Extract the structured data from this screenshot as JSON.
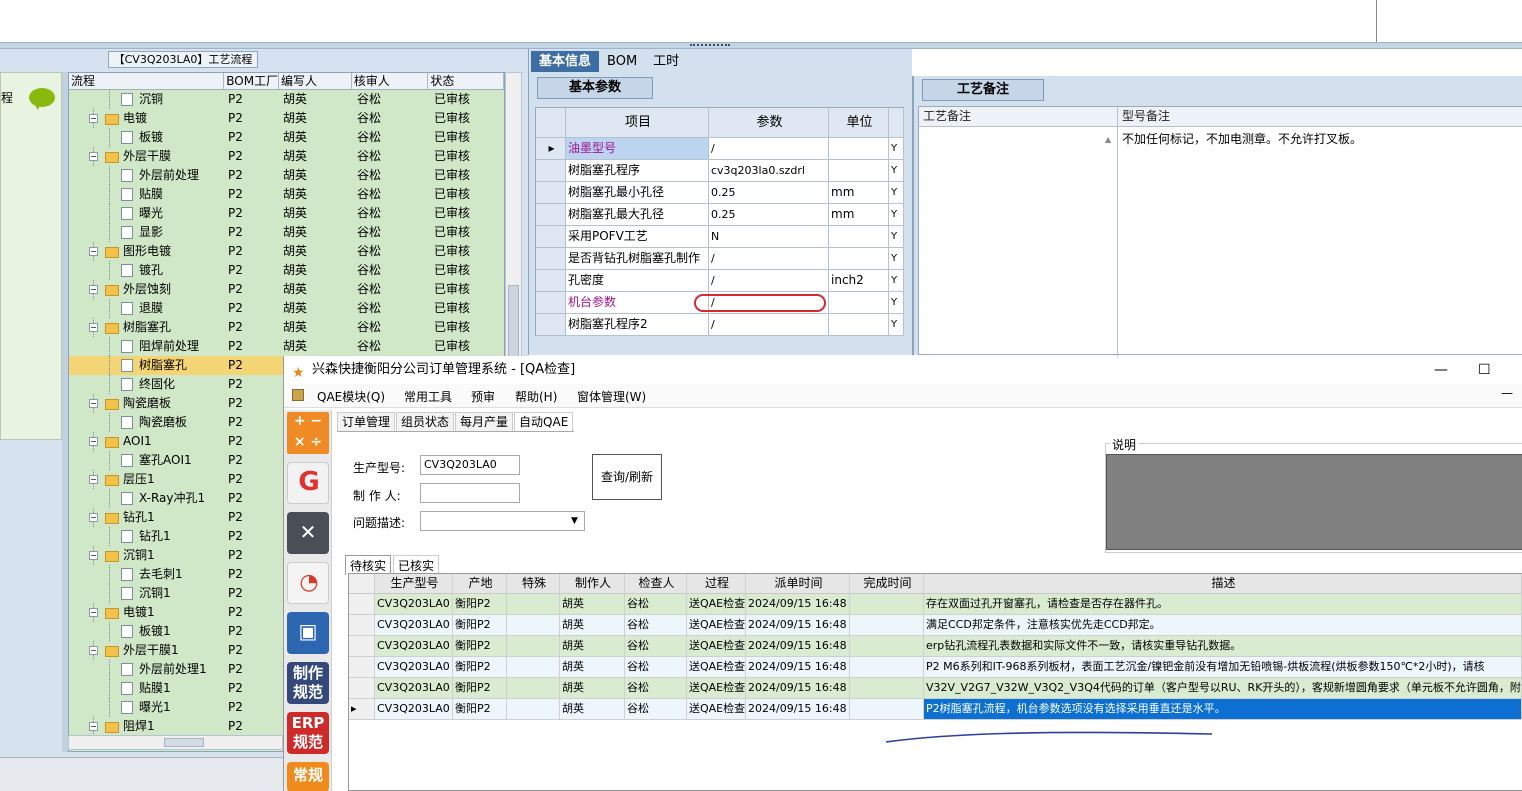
{
  "left_panel": {
    "title": "【CV3Q203LA0】工艺流程",
    "side_label": "程",
    "columns": [
      "流程",
      "BOM工厂",
      "编写人",
      "核审人",
      "状态"
    ],
    "rows": [
      {
        "name": "沉铜",
        "level": 2,
        "kind": "doc",
        "bom": "P2",
        "writer": "胡英",
        "reviewer": "谷松",
        "status": "已审核"
      },
      {
        "name": "电镀",
        "level": 1,
        "kind": "folder",
        "bom": "P2",
        "writer": "胡英",
        "reviewer": "谷松",
        "status": "已审核"
      },
      {
        "name": "板镀",
        "level": 2,
        "kind": "doc",
        "bom": "P2",
        "writer": "胡英",
        "reviewer": "谷松",
        "status": "已审核"
      },
      {
        "name": "外层干膜",
        "level": 1,
        "kind": "folder",
        "bom": "P2",
        "writer": "胡英",
        "reviewer": "谷松",
        "status": "已审核"
      },
      {
        "name": "外层前处理",
        "level": 2,
        "kind": "doc",
        "bom": "P2",
        "writer": "胡英",
        "reviewer": "谷松",
        "status": "已审核"
      },
      {
        "name": "贴膜",
        "level": 2,
        "kind": "doc",
        "bom": "P2",
        "writer": "胡英",
        "reviewer": "谷松",
        "status": "已审核"
      },
      {
        "name": "曝光",
        "level": 2,
        "kind": "doc",
        "bom": "P2",
        "writer": "胡英",
        "reviewer": "谷松",
        "status": "已审核"
      },
      {
        "name": "显影",
        "level": 2,
        "kind": "doc",
        "bom": "P2",
        "writer": "胡英",
        "reviewer": "谷松",
        "status": "已审核"
      },
      {
        "name": "图形电镀",
        "level": 1,
        "kind": "folder",
        "bom": "P2",
        "writer": "胡英",
        "reviewer": "谷松",
        "status": "已审核"
      },
      {
        "name": "镀孔",
        "level": 2,
        "kind": "doc",
        "bom": "P2",
        "writer": "胡英",
        "reviewer": "谷松",
        "status": "已审核"
      },
      {
        "name": "外层蚀刻",
        "level": 1,
        "kind": "folder",
        "bom": "P2",
        "writer": "胡英",
        "reviewer": "谷松",
        "status": "已审核"
      },
      {
        "name": "退膜",
        "level": 2,
        "kind": "doc",
        "bom": "P2",
        "writer": "胡英",
        "reviewer": "谷松",
        "status": "已审核"
      },
      {
        "name": "树脂塞孔",
        "level": 1,
        "kind": "folder",
        "bom": "P2",
        "writer": "胡英",
        "reviewer": "谷松",
        "status": "已审核"
      },
      {
        "name": "阻焊前处理",
        "level": 2,
        "kind": "doc",
        "bom": "P2",
        "writer": "胡英",
        "reviewer": "谷松",
        "status": "已审核"
      },
      {
        "name": "树脂塞孔",
        "level": 2,
        "kind": "doc",
        "bom": "P2",
        "writer": "",
        "reviewer": "",
        "status": "",
        "selected": true
      },
      {
        "name": "终固化",
        "level": 2,
        "kind": "doc",
        "bom": "P2",
        "writer": "",
        "reviewer": "",
        "status": ""
      },
      {
        "name": "陶瓷磨板",
        "level": 1,
        "kind": "folder",
        "bom": "P2",
        "writer": "",
        "reviewer": "",
        "status": ""
      },
      {
        "name": "陶瓷磨板",
        "level": 2,
        "kind": "doc",
        "bom": "P2",
        "writer": "",
        "reviewer": "",
        "status": ""
      },
      {
        "name": "AOI1",
        "level": 1,
        "kind": "folder",
        "bom": "P2",
        "writer": "",
        "reviewer": "",
        "status": ""
      },
      {
        "name": "塞孔AOI1",
        "level": 2,
        "kind": "doc",
        "bom": "P2",
        "writer": "",
        "reviewer": "",
        "status": ""
      },
      {
        "name": "层压1",
        "level": 1,
        "kind": "folder",
        "bom": "P2",
        "writer": "",
        "reviewer": "",
        "status": ""
      },
      {
        "name": "X-Ray冲孔1",
        "level": 2,
        "kind": "doc",
        "bom": "P2",
        "writer": "",
        "reviewer": "",
        "status": ""
      },
      {
        "name": "钻孔1",
        "level": 1,
        "kind": "folder",
        "bom": "P2",
        "writer": "",
        "reviewer": "",
        "status": ""
      },
      {
        "name": "钻孔1",
        "level": 2,
        "kind": "doc",
        "bom": "P2",
        "writer": "",
        "reviewer": "",
        "status": ""
      },
      {
        "name": "沉铜1",
        "level": 1,
        "kind": "folder",
        "bom": "P2",
        "writer": "",
        "reviewer": "",
        "status": ""
      },
      {
        "name": "去毛刺1",
        "level": 2,
        "kind": "doc",
        "bom": "P2",
        "writer": "",
        "reviewer": "",
        "status": ""
      },
      {
        "name": "沉铜1",
        "level": 2,
        "kind": "doc",
        "bom": "P2",
        "writer": "",
        "reviewer": "",
        "status": ""
      },
      {
        "name": "电镀1",
        "level": 1,
        "kind": "folder",
        "bom": "P2",
        "writer": "",
        "reviewer": "",
        "status": ""
      },
      {
        "name": "板镀1",
        "level": 2,
        "kind": "doc",
        "bom": "P2",
        "writer": "",
        "reviewer": "",
        "status": ""
      },
      {
        "name": "外层干膜1",
        "level": 1,
        "kind": "folder",
        "bom": "P2",
        "writer": "",
        "reviewer": "",
        "status": ""
      },
      {
        "name": "外层前处理1",
        "level": 2,
        "kind": "doc",
        "bom": "P2",
        "writer": "",
        "reviewer": "",
        "status": ""
      },
      {
        "name": "贴膜1",
        "level": 2,
        "kind": "doc",
        "bom": "P2",
        "writer": "",
        "reviewer": "",
        "status": ""
      },
      {
        "name": "曝光1",
        "level": 2,
        "kind": "doc",
        "bom": "P2",
        "writer": "",
        "reviewer": "",
        "status": ""
      },
      {
        "name": "阻焊1",
        "level": 1,
        "kind": "folder",
        "bom": "P2",
        "writer": "",
        "reviewer": "",
        "status": ""
      }
    ]
  },
  "basic_info": {
    "tabs": [
      "基本信息",
      "BOM",
      "工时"
    ],
    "sub_tab": "基本参数",
    "columns": [
      "项目",
      "参数",
      "单位"
    ],
    "rows": [
      {
        "item": "油墨型号",
        "param": "/",
        "unit": "",
        "flag": "Y",
        "current": true
      },
      {
        "item": "树脂塞孔程序",
        "param": "cv3q203la0.szdrl",
        "unit": "",
        "flag": "Y"
      },
      {
        "item": "树脂塞孔最小孔径",
        "param": "0.25",
        "unit": "mm",
        "flag": "Y"
      },
      {
        "item": "树脂塞孔最大孔径",
        "param": "0.25",
        "unit": "mm",
        "flag": "Y"
      },
      {
        "item": "采用POFV工艺",
        "param": "N",
        "unit": "",
        "flag": "Y"
      },
      {
        "item": "是否背钻孔树脂塞孔制作",
        "param": "/",
        "unit": "",
        "flag": "Y"
      },
      {
        "item": "孔密度",
        "param": "/",
        "unit": "inch2",
        "flag": "Y"
      },
      {
        "item": "机台参数",
        "param": "/",
        "unit": "",
        "flag": "Y",
        "pink": true
      },
      {
        "item": "树脂塞孔程序2",
        "param": "/",
        "unit": "",
        "flag": "Y"
      }
    ]
  },
  "process_notes": {
    "tab": "工艺备注",
    "col1": "工艺备注",
    "col2": "型号备注",
    "model_note": "不加任何标记，不加电测章。不允许打叉板。"
  },
  "qa_window": {
    "title": "兴森快捷衡阳分公司订单管理系统 - [QA检查]",
    "menu": [
      "QAE模块(Q)",
      "常用工具",
      "预审",
      "帮助(H)",
      "窗体管理(W)"
    ],
    "window_buttons": {
      "minimize": "—",
      "maximize": "☐"
    },
    "side_buttons": {
      "make_rule": "制作规范",
      "erp_rule": "ERP规范",
      "common_rule": "常规"
    },
    "tabs": [
      "订单管理",
      "组员状态",
      "每月产量",
      "自动QAE"
    ],
    "form": {
      "model_label": "生产型号:",
      "model_value": "CV3Q203LA0",
      "maker_label": "制 作 人:",
      "maker_value": "",
      "issue_label": "问题描述:",
      "issue_value": "",
      "query_button": "查询/刷新"
    },
    "explain_label": "说明",
    "result_tabs": [
      "待核实",
      "已核实"
    ],
    "grid_columns": [
      "生产型号",
      "产地",
      "特殊",
      "制作人",
      "检查人",
      "过程",
      "派单时间",
      "完成时间",
      "描述"
    ],
    "grid_rows": [
      {
        "model": "CV3Q203LA0",
        "site": "衡阳P2",
        "special": "",
        "maker": "胡英",
        "checker": "谷松",
        "process": "送QAE检查",
        "dispatch": "2024/09/15 16:48",
        "finish": "",
        "desc": "存在双面过孔开窗塞孔，请检查是否存在器件孔。"
      },
      {
        "model": "CV3Q203LA0",
        "site": "衡阳P2",
        "special": "",
        "maker": "胡英",
        "checker": "谷松",
        "process": "送QAE检查",
        "dispatch": "2024/09/15 16:48",
        "finish": "",
        "desc": "满足CCD邦定条件，注意核实优先走CCD邦定。"
      },
      {
        "model": "CV3Q203LA0",
        "site": "衡阳P2",
        "special": "",
        "maker": "胡英",
        "checker": "谷松",
        "process": "送QAE检查",
        "dispatch": "2024/09/15 16:48",
        "finish": "",
        "desc": "erp钻孔流程孔表数据和实际文件不一致，请核实重导钻孔数据。"
      },
      {
        "model": "CV3Q203LA0",
        "site": "衡阳P2",
        "special": "",
        "maker": "胡英",
        "checker": "谷松",
        "process": "送QAE检查",
        "dispatch": "2024/09/15 16:48",
        "finish": "",
        "desc": "P2 M6系列和IT-968系列板材，表面工艺沉金/镍钯金前没有增加无铅喷锡-烘板流程(烘板参数150℃*2小时)，请核"
      },
      {
        "model": "CV3Q203LA0",
        "site": "衡阳P2",
        "special": "",
        "maker": "胡英",
        "checker": "谷松",
        "process": "送QAE检查",
        "dispatch": "2024/09/15 16:48",
        "finish": "",
        "desc": "V32V_V2G7_V32W_V3Q2_V3Q4代码的订单（客户型号以RU、RK开头的），客规新增圆角要求（单元板不允许圆角，附边"
      },
      {
        "model": "CV3Q203LA0",
        "site": "衡阳P2",
        "special": "",
        "maker": "胡英",
        "checker": "谷松",
        "process": "送QAE检查",
        "dispatch": "2024/09/15 16:48",
        "finish": "",
        "desc": "P2树脂塞孔流程，机台参数选项没有选择采用垂直还是水平。",
        "selected": true
      }
    ]
  }
}
